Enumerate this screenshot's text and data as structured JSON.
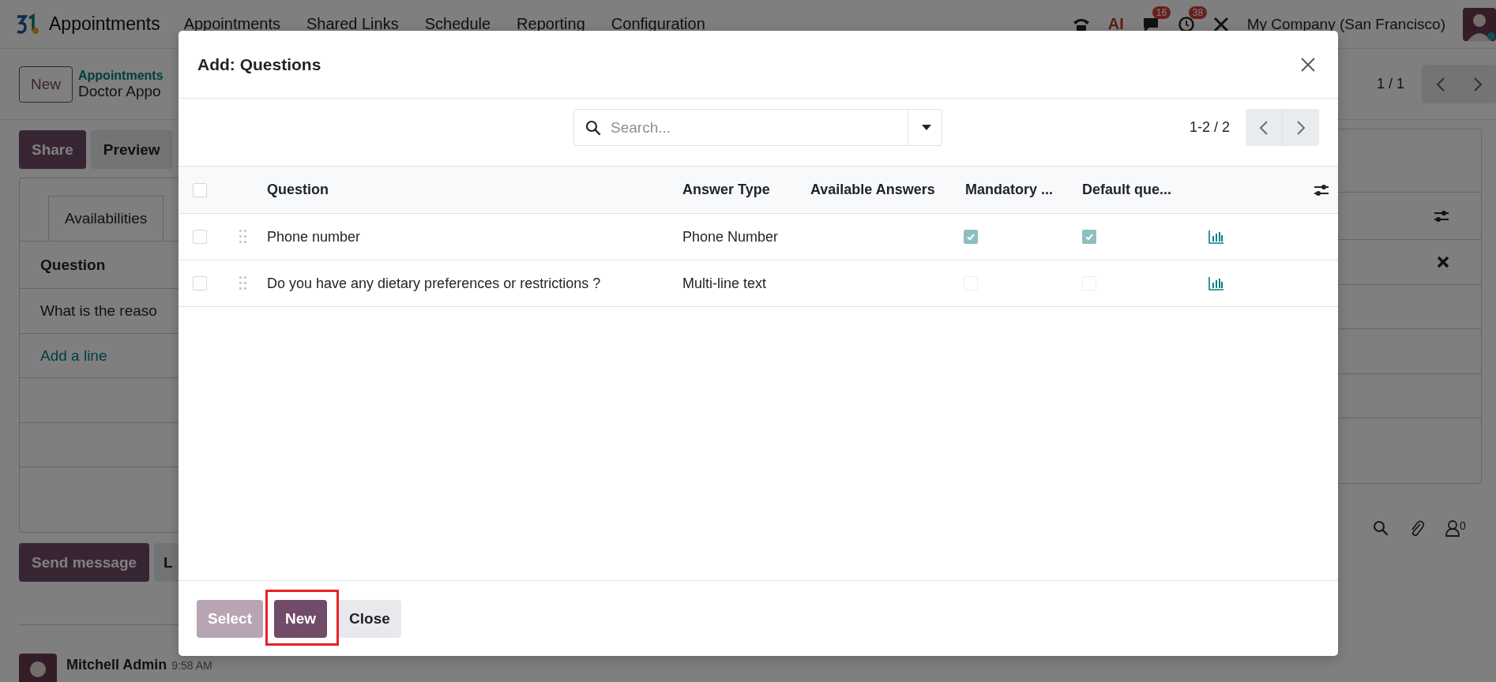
{
  "navbar": {
    "app_name": "Appointments",
    "menu": [
      "Appointments",
      "Shared Links",
      "Schedule",
      "Reporting",
      "Configuration"
    ],
    "ai_label": "AI",
    "notifications": [
      {
        "kind": "chat",
        "count": "16"
      },
      {
        "kind": "activity",
        "count": "38"
      }
    ],
    "company": "My Company (San Francisco)"
  },
  "control_panel": {
    "new_button": "New",
    "breadcrumb": [
      "Appointments",
      "Doctor Appo"
    ],
    "pager": "1 / 1"
  },
  "actions": [
    "Share",
    "Preview"
  ],
  "form": {
    "tab": "Availabilities",
    "column": "Question",
    "rows": [
      "What is the reaso"
    ],
    "add_line": "Add a line"
  },
  "chatter": {
    "send_button": "Send message",
    "log_button": "L",
    "follower_count": "0",
    "messages": [
      {
        "author": "Mitchell Admin",
        "time": "9:58 AM"
      }
    ]
  },
  "dialog": {
    "title": "Add: Questions",
    "search": {
      "placeholder": "Search..."
    },
    "pager": "1-2 / 2",
    "all_checked": false,
    "columns": [
      "Question",
      "Answer Type",
      "Available Answers",
      "Mandatory ...",
      "Default que..."
    ],
    "rows": [
      {
        "question": "Phone number",
        "answer_type": "Phone Number",
        "checked": false,
        "mandatory": true,
        "default": true
      },
      {
        "question": "Do you have any dietary preferences or restrictions ?",
        "answer_type": "Multi-line text",
        "checked": false,
        "mandatory": false,
        "default": false
      }
    ],
    "buttons": [
      {
        "label": "Select",
        "kind": "primary",
        "disabled": true,
        "highlighted": false
      },
      {
        "label": "New",
        "kind": "primary",
        "disabled": false,
        "highlighted": true
      },
      {
        "label": "Close",
        "kind": "secondary",
        "disabled": false,
        "highlighted": false
      }
    ]
  }
}
